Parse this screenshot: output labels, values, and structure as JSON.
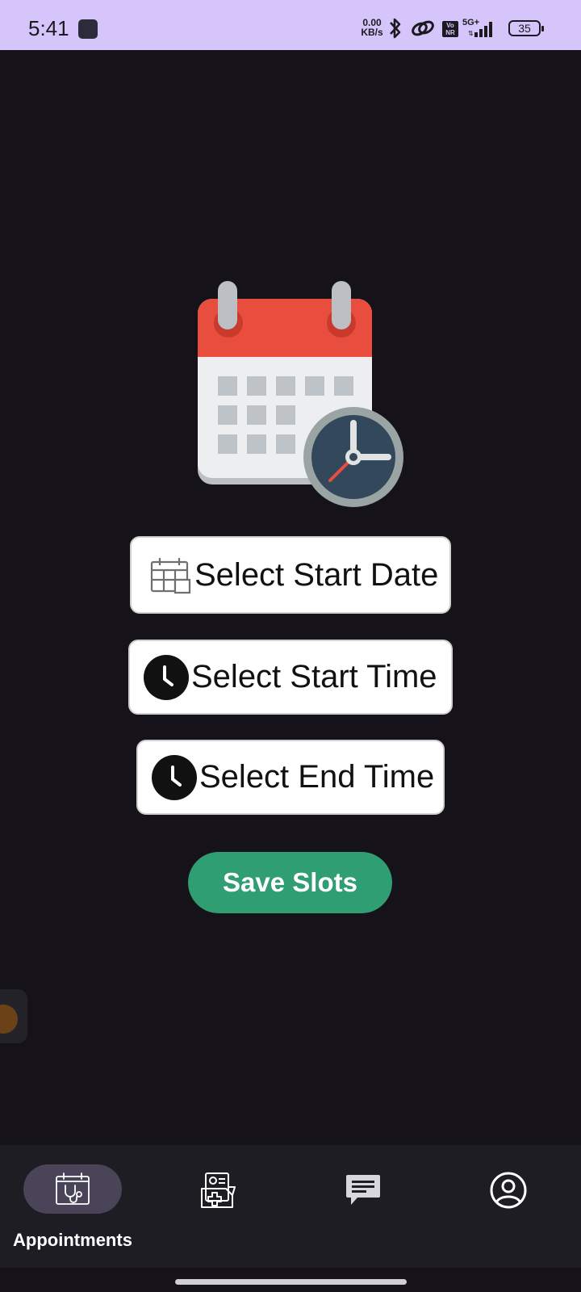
{
  "status_bar": {
    "time": "5:41",
    "net_speed_value": "0.00",
    "net_speed_unit": "KB/s",
    "vonr": "Vo NR",
    "network": "5G+",
    "battery": "35",
    "background_color": "#d6c5fb"
  },
  "actions": {
    "select_start_date": "Select Start Date",
    "select_start_time": "Select Start Time",
    "select_end_time": "Select End Time",
    "save_slots": "Save Slots"
  },
  "bottom_nav": {
    "items": [
      {
        "label": "Appointments",
        "icon": "appointment-calendar-icon",
        "selected": true
      },
      {
        "label": "",
        "icon": "medical-records-icon",
        "selected": false
      },
      {
        "label": "",
        "icon": "chat-icon",
        "selected": false
      },
      {
        "label": "",
        "icon": "profile-icon",
        "selected": false
      }
    ]
  },
  "colors": {
    "background": "#15121a",
    "save_button": "#2f9e72",
    "nav_background": "#1f1d24",
    "nav_pill": "#4a4458"
  }
}
